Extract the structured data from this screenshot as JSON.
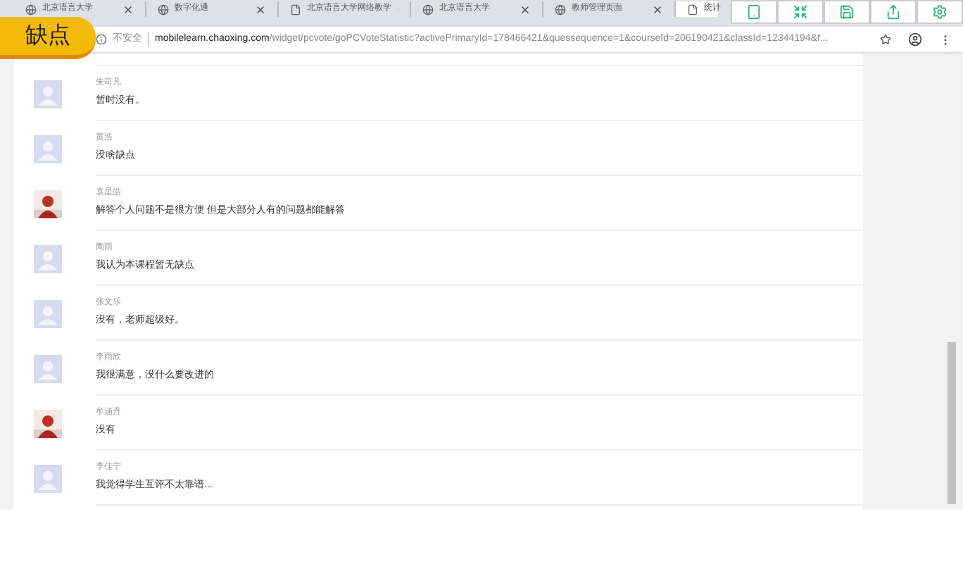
{
  "badge": "缺点",
  "tabs": [
    {
      "title": "北京语言大学",
      "selected": false
    },
    {
      "title": "数字化通",
      "selected": false
    },
    {
      "title": "北京语言大学网络教学",
      "selected": false
    },
    {
      "title": "北京语言大学",
      "selected": false
    },
    {
      "title": "教师管理页面",
      "selected": false
    },
    {
      "title": "统计",
      "selected": true
    }
  ],
  "address_bar": {
    "security": "不安全",
    "host": "mobilelearn.chaoxing.com",
    "path": "/widget/pcvote/goPCVoteStatistic?activePrimaryId=178466421&quessequence=1&courseId=206190421&classId=12344194&f..."
  },
  "comments": [
    {
      "name": "朱司凡",
      "text": "暂时没有。"
    },
    {
      "name": "黄浩",
      "text": "没啥缺点"
    },
    {
      "name": "袁星皓",
      "text": "解答个人问题不是很方便 但是大部分人有的问题都能解答",
      "kind": "picture"
    },
    {
      "name": "陶雨",
      "text": "我认为本课程暂无缺点"
    },
    {
      "name": "张文乐",
      "text": "没有，老师超级好。"
    },
    {
      "name": "李雨欣",
      "text": "我很满意，没什么要改进的"
    },
    {
      "name": "牟涵丹",
      "text": "没有",
      "kind": "picture"
    },
    {
      "name": "李佳宁",
      "text": "我觉得学生互评不太靠谱..."
    }
  ]
}
